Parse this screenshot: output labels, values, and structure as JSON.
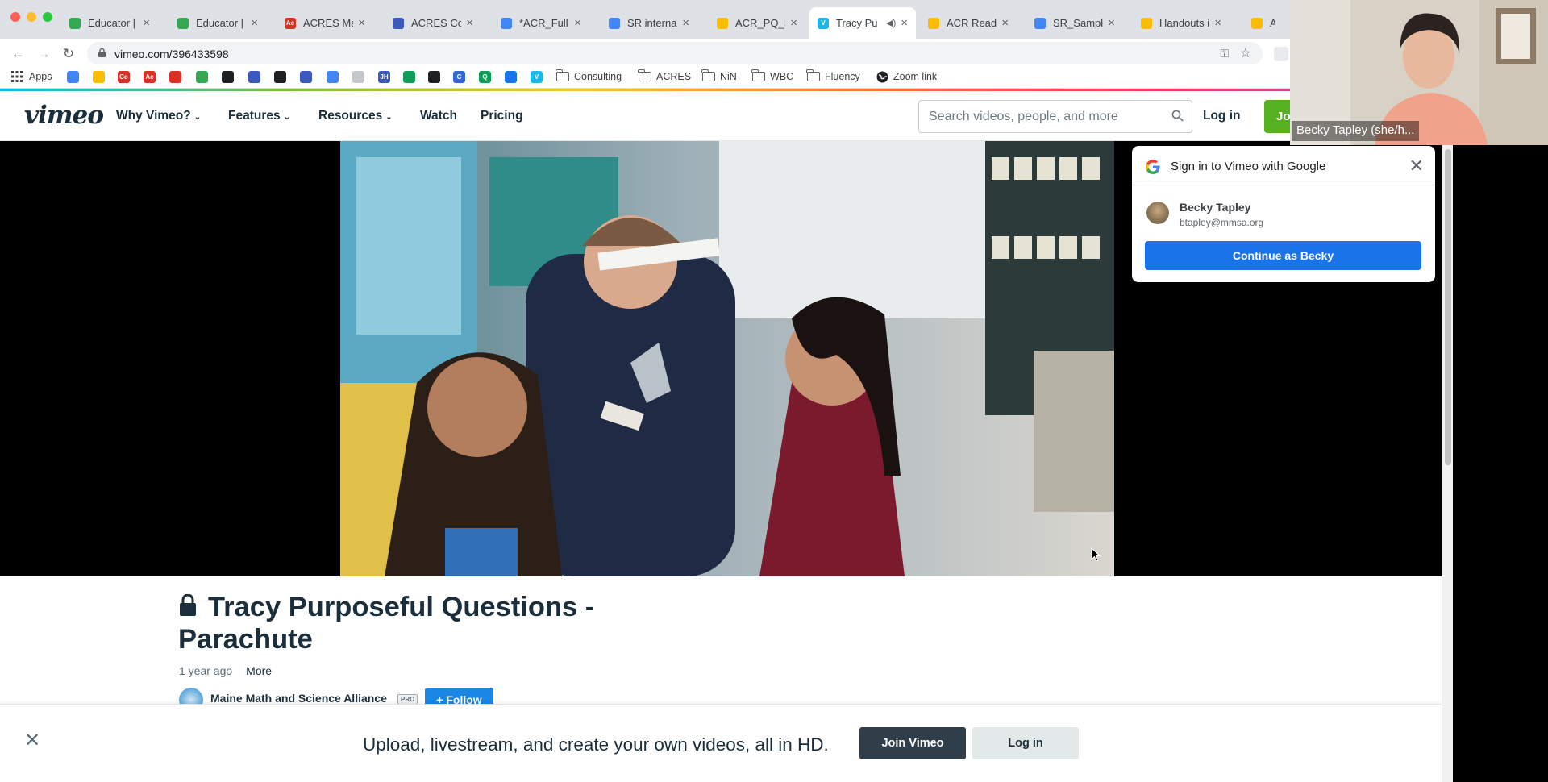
{
  "browser": {
    "tabs": [
      {
        "title": "Educator | T",
        "color": "#34a853",
        "glyph": ""
      },
      {
        "title": "Educator | T",
        "color": "#34a853",
        "glyph": ""
      },
      {
        "title": "ACRES Mast",
        "color": "#d93025",
        "glyph": "Ac"
      },
      {
        "title": "ACRES Coac",
        "color": "#3c5abd",
        "glyph": ""
      },
      {
        "title": "*ACR_Full M",
        "color": "#4285f4",
        "glyph": ""
      },
      {
        "title": "SR internal r",
        "color": "#4285f4",
        "glyph": ""
      },
      {
        "title": "ACR_PQ_Sta",
        "color": "#fbbc04",
        "glyph": ""
      },
      {
        "title": "Tracy Pu",
        "color": "#1ab7ea",
        "glyph": "V"
      },
      {
        "title": "ACR Ready",
        "color": "#fbbc04",
        "glyph": ""
      },
      {
        "title": "SR_Sample",
        "color": "#4285f4",
        "glyph": ""
      },
      {
        "title": "Handouts in",
        "color": "#fbbc04",
        "glyph": ""
      },
      {
        "title": "AC",
        "color": "#fbbc04",
        "glyph": ""
      }
    ],
    "url": "vimeo.com/396433598",
    "bookmarks": {
      "apps_label": "Apps",
      "folders": [
        {
          "label": "Consulting"
        },
        {
          "label": "ACRES"
        },
        {
          "label": "NiN"
        },
        {
          "label": "WBC"
        },
        {
          "label": "Fluency"
        }
      ],
      "zoom_link": "Zoom link",
      "icon_colors": [
        "#4285f4",
        "#fbbc04",
        "#d93025",
        "#d93025",
        "#d93025",
        "#34a853",
        "#202124",
        "#3c5abd",
        "#202124",
        "#3c5abd",
        "#4285f4",
        "#c4c7cc",
        "#3c5abd",
        "#0f9d58",
        "#202124",
        "#3367d6",
        "#0f9d58",
        "#1a73e8",
        "#1ab7ea"
      ],
      "icon_glyphs": [
        "",
        "",
        "Co",
        "Ac",
        "",
        "",
        "",
        "",
        "",
        "",
        "",
        "",
        "JH",
        "",
        "",
        "C",
        "Q",
        "",
        "V"
      ]
    }
  },
  "vimeo": {
    "logo": "vimeo",
    "nav": [
      {
        "label": "Why Vimeo?",
        "chevron": true
      },
      {
        "label": "Features",
        "chevron": true
      },
      {
        "label": "Resources",
        "chevron": true
      },
      {
        "label": "Watch",
        "chevron": false
      },
      {
        "label": "Pricing",
        "chevron": false
      }
    ],
    "search_placeholder": "Search videos, people, and more",
    "login": "Log in",
    "join": "Join",
    "accent": "#55b120"
  },
  "google_signin": {
    "title": "Sign in to Vimeo with Google",
    "name": "Becky Tapley",
    "email": "btapley@mmsa.org",
    "continue": "Continue as Becky"
  },
  "video": {
    "title": "Tracy Purposeful Questions - Parachute",
    "age": "1 year ago",
    "more": "More",
    "owner": "Maine Math and Science Alliance",
    "badge": "PRO",
    "follow": "+ Follow"
  },
  "banner": {
    "text": "Upload, livestream, and create your own videos, all in HD.",
    "join": "Join Vimeo",
    "login": "Log in"
  },
  "zoom": {
    "participant": "Becky Tapley (she/h..."
  }
}
